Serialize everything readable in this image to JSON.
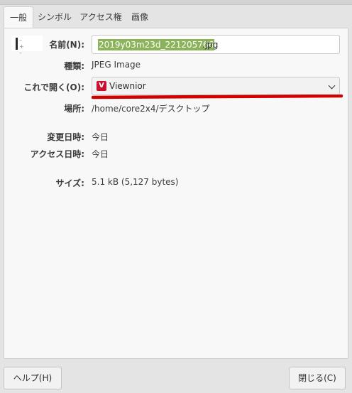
{
  "tabs": [
    {
      "label": "一般",
      "active": true
    },
    {
      "label": "シンボル",
      "active": false
    },
    {
      "label": "アクセス権",
      "active": false
    },
    {
      "label": "画像",
      "active": false
    }
  ],
  "fields": {
    "name_label": "名前(N):",
    "name_selected": "2019y03m23d_221205766",
    "name_extension": ".jpg",
    "type_label": "種類:",
    "type_value": "JPEG Image",
    "open_with_label": "これで開く(O):",
    "open_with_value": "Viewnior",
    "open_with_icon": "V",
    "location_label": "場所:",
    "location_value": "/home/core2x4/デスクトップ",
    "modified_label": "変更日時:",
    "modified_value": "今日",
    "accessed_label": "アクセス日時:",
    "accessed_value": "今日",
    "size_label": "サイズ:",
    "size_value": "5.1 kB (5,127 bytes)"
  },
  "buttons": {
    "help": "ヘルプ(H)",
    "close": "閉じる(C)"
  },
  "colors": {
    "selection": "#8ab35a",
    "app_icon": "#c8102e",
    "annotation": "#d40000"
  }
}
